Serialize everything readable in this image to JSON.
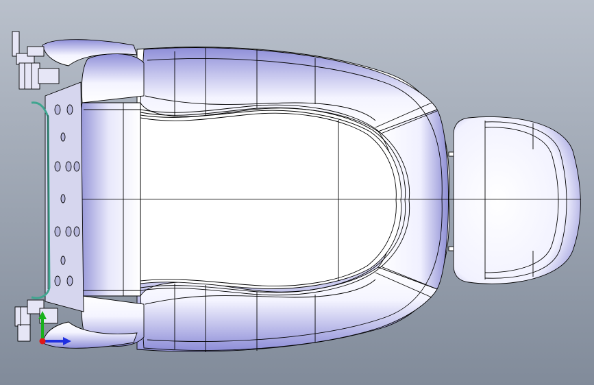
{
  "viewport": {
    "background_top": "#b9c0cb",
    "background_bottom": "#818b9a"
  },
  "model": {
    "fill_color": "#ffffff",
    "shade_color": "#8f8fd6",
    "edge_color": "#000000",
    "bracket_shade": "#aaaacc",
    "rod_color": "#3fa58f"
  },
  "triad": {
    "x_axis_color": "#1f2fe0",
    "y_axis_color": "#17b21b",
    "z_axis_color": "#e01818"
  }
}
